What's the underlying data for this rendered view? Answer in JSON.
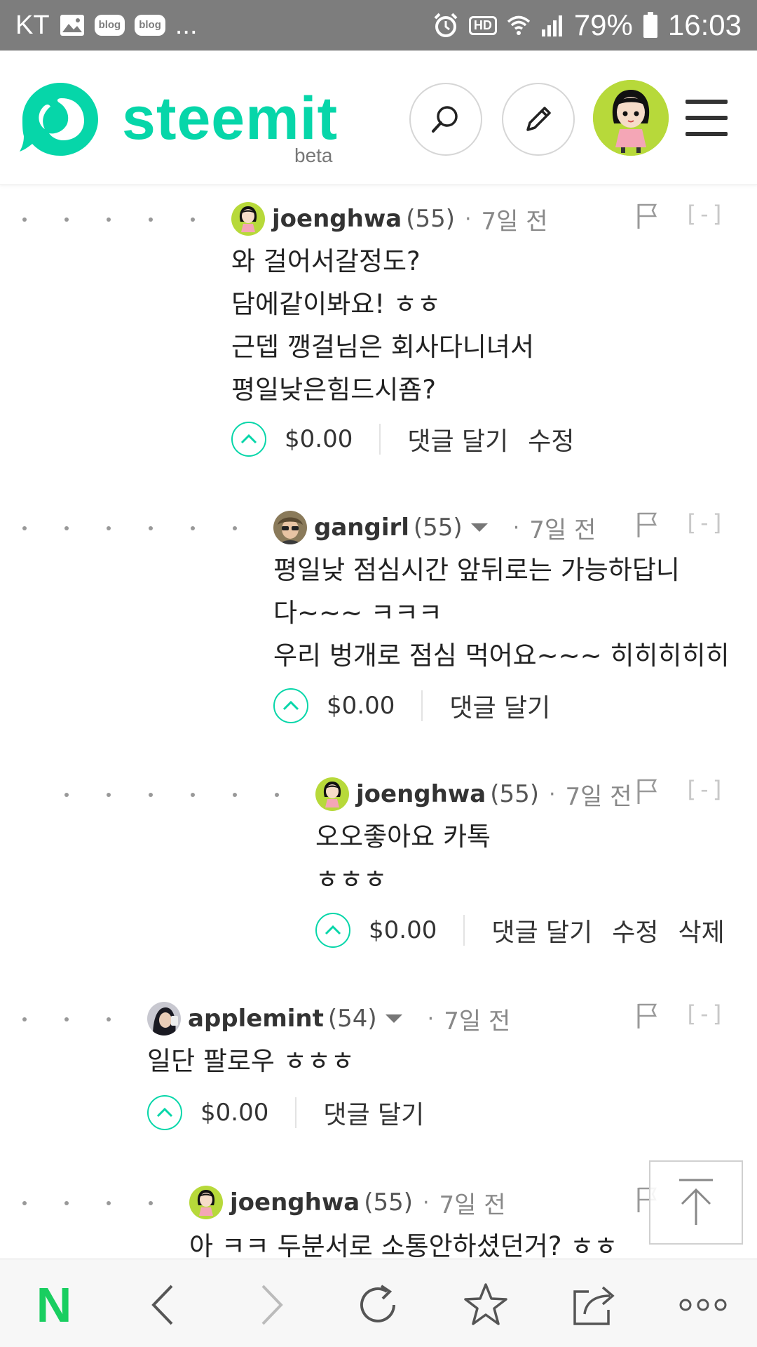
{
  "status_bar": {
    "carrier": "KT",
    "blog_badge": "blog",
    "more": "...",
    "hd": "HD",
    "battery": "79%",
    "time": "16:03"
  },
  "header": {
    "logo_text": "steemit",
    "logo_beta": "beta",
    "brand_color": "#06d6a9"
  },
  "comments": [
    {
      "author": "joenghwa",
      "reputation": "(55)",
      "separator": "·",
      "time": "7일 전",
      "collapse": "[-]",
      "body": [
        "와 걸어서갈정도?",
        "담에같이봐요! ㅎㅎ",
        "근뎁 깽걸님은 회사다니녀서",
        "평일낮은힘드시죰?"
      ],
      "payout": "$0.00",
      "actions": [
        "댓글 달기",
        "수정"
      ]
    },
    {
      "author": "gangirl",
      "reputation": "(55)",
      "separator": "·",
      "time": "7일 전",
      "collapse": "[-]",
      "body": [
        "평일낮 점심시간 앞뒤로는 가능하답니",
        "다~~~ ㅋㅋㅋ",
        "우리 벙개로 점심 먹어요~~~ 히히히히히"
      ],
      "payout": "$0.00",
      "actions": [
        "댓글 달기"
      ]
    },
    {
      "author": "joenghwa",
      "reputation": "(55)",
      "separator": "·",
      "time": "7일 전",
      "collapse": "[-]",
      "body": [
        "오오좋아요 카톡",
        "ㅎㅎㅎ"
      ],
      "payout": "$0.00",
      "actions": [
        "댓글 달기",
        "수정",
        "삭제"
      ]
    },
    {
      "author": "applemint",
      "reputation": "(54)",
      "separator": "·",
      "time": "7일 전",
      "collapse": "[-]",
      "body": [
        "일단 팔로우 ㅎㅎㅎ"
      ],
      "payout": "$0.00",
      "actions": [
        "댓글 달기"
      ]
    },
    {
      "author": "joenghwa",
      "reputation": "(55)",
      "separator": "·",
      "time": "7일 전",
      "body": [
        "아 ㅋㅋ 두분서로 소통안하셨던거? ㅎㅎ"
      ]
    }
  ],
  "bottom_nav": {
    "naver": "N"
  }
}
